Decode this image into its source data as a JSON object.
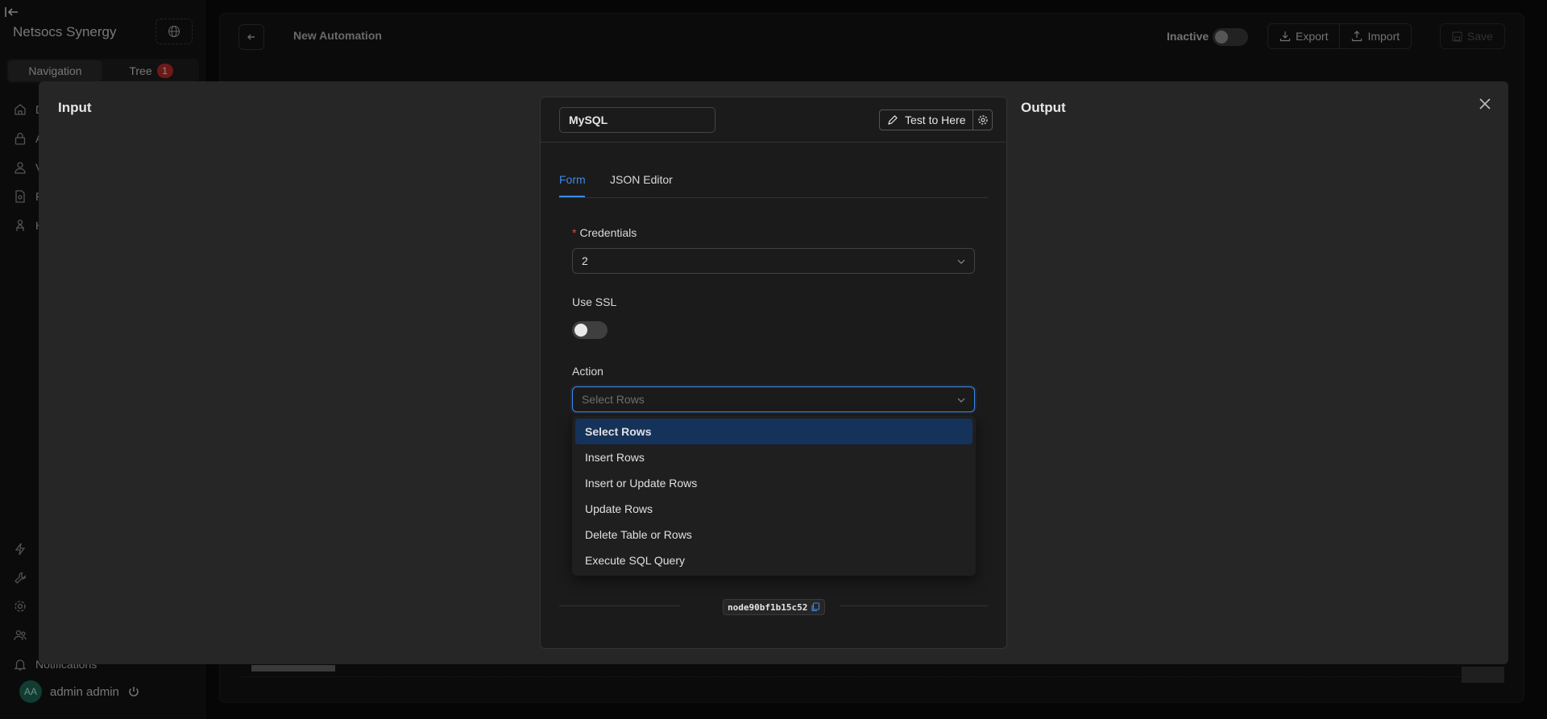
{
  "app": {
    "brand": "Netsocs Synergy",
    "segment": {
      "navigation": "Navigation",
      "tree": "Tree",
      "tree_badge": "1"
    },
    "sidebar_items": [
      {
        "label": "D",
        "icon": "home-icon"
      },
      {
        "label": "A",
        "icon": "lock-icon"
      },
      {
        "label": "V",
        "icon": "user-icon"
      },
      {
        "label": "R",
        "icon": "file-icon"
      },
      {
        "label": "H",
        "icon": "person-desk-icon"
      }
    ],
    "sidebar_bottom": {
      "notifications": "Notifications"
    },
    "user": {
      "initials": "AA",
      "name": "admin admin"
    }
  },
  "header": {
    "title": "New Automation",
    "status_label": "Inactive",
    "export_label": "Export",
    "import_label": "Import",
    "save_label": "Save"
  },
  "modal": {
    "input_title": "Input",
    "output_title": "Output",
    "node": {
      "name": "MySQL",
      "test_label": "Test to Here",
      "tabs": [
        "Form",
        "JSON Editor"
      ],
      "active_tab": "Form",
      "credentials_label": "Credentials",
      "credentials_value": "2",
      "use_ssl_label": "Use SSL",
      "use_ssl": false,
      "action_label": "Action",
      "action_placeholder": "Select Rows",
      "action_options": [
        "Select Rows",
        "Insert Rows",
        "Insert or Update Rows",
        "Update Rows",
        "Delete Table or Rows",
        "Execute SQL Query"
      ],
      "highlighted_option": "Select Rows",
      "node_id": "node90bf1b15c52"
    }
  },
  "colors": {
    "accent": "#3c89e8",
    "badge": "#c4302b",
    "required": "#e04444",
    "selected_option_bg": "#15325b"
  }
}
